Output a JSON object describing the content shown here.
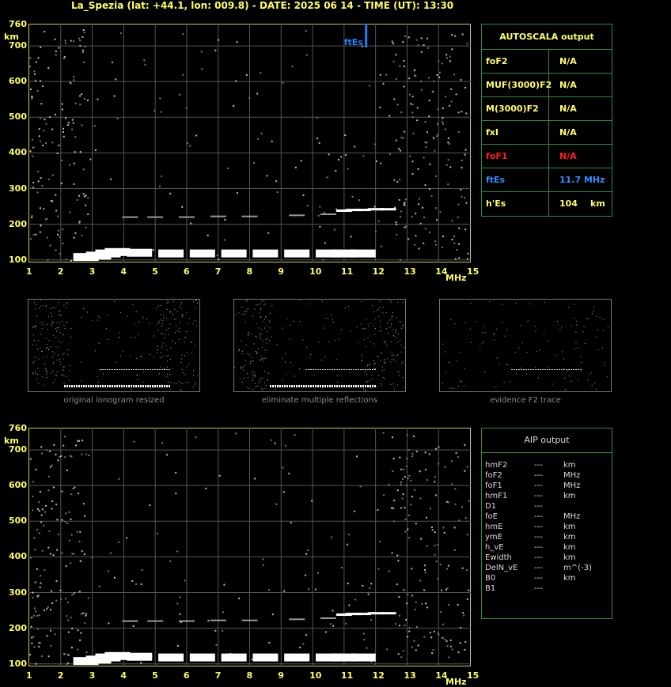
{
  "title": "La_Spezia (lat: +44.1, lon: 009.8) - DATE: 2025 06 14 - TIME (UT): 13:30",
  "chart_data": [
    {
      "type": "scatter",
      "title": "",
      "xlabel": "MHz",
      "ylabel": "km",
      "xlim": [
        1,
        15
      ],
      "ylim": [
        95,
        760
      ],
      "x_ticks": [
        "1",
        "2",
        "3",
        "4",
        "5",
        "6",
        "7",
        "8",
        "9",
        "10",
        "11",
        "12",
        "13",
        "14",
        "15"
      ],
      "y_ticks": [
        "760",
        "700",
        "600",
        "500",
        "400",
        "300",
        "200",
        "100"
      ],
      "grid": true,
      "traces": [
        {
          "name": "E trace",
          "x": [
            2.8,
            3.2,
            3.5,
            3.8,
            4.5,
            5.5,
            6.5,
            7.5,
            8.5,
            9.5,
            10.5,
            11.0,
            11.6
          ],
          "y": [
            108,
            112,
            118,
            122,
            120,
            118,
            118,
            118,
            118,
            118,
            118,
            118,
            118
          ]
        },
        {
          "name": "Es trace",
          "x": [
            11.0,
            11.3,
            11.6,
            12.0,
            12.4
          ],
          "y": [
            238,
            240,
            240,
            242,
            242
          ]
        },
        {
          "name": "faint trace",
          "x": [
            4.2,
            5.0,
            6.0,
            7.0,
            8.0,
            9.5,
            10.5
          ],
          "y": [
            220,
            220,
            220,
            222,
            222,
            225,
            228
          ]
        }
      ],
      "markers": [
        {
          "label": "ftEs",
          "x": 11.7,
          "color": "#1e7fff"
        }
      ]
    },
    {
      "type": "scatter",
      "title": "",
      "xlabel": "MHz",
      "ylabel": "km",
      "xlim": [
        1,
        15
      ],
      "ylim": [
        95,
        760
      ],
      "x_ticks": [
        "1",
        "2",
        "3",
        "4",
        "5",
        "6",
        "7",
        "8",
        "9",
        "10",
        "11",
        "12",
        "13",
        "14",
        "15"
      ],
      "y_ticks": [
        "760",
        "700",
        "600",
        "500",
        "400",
        "300",
        "200",
        "100"
      ],
      "grid": true
    }
  ],
  "autoscala": {
    "title": "AUTOSCALA output",
    "rows": [
      {
        "name": "foF2",
        "value": "N/A",
        "unit": "",
        "color": "#ffff66"
      },
      {
        "name": "MUF(3000)F2",
        "value": "N/A",
        "unit": "",
        "color": "#ffff66"
      },
      {
        "name": "M(3000)F2",
        "value": "N/A",
        "unit": "",
        "color": "#ffff66"
      },
      {
        "name": "fxI",
        "value": "N/A",
        "unit": "",
        "color": "#ffff66"
      },
      {
        "name": "foF1",
        "value": "N/A",
        "unit": "",
        "color": "#ff1e1e"
      },
      {
        "name": "ftEs",
        "value": "11.7 MHz",
        "unit": "",
        "color": "#2f8fff"
      },
      {
        "name": "h'Es",
        "value": "104",
        "unit": "km",
        "color": "#ffff66"
      }
    ]
  },
  "thumbnails": [
    {
      "caption": "original ionogram resized"
    },
    {
      "caption": "eliminate multiple reflections"
    },
    {
      "caption": "evidence F2 trace"
    }
  ],
  "aip": {
    "title": "AIP output",
    "rows": [
      {
        "name": "hmF2",
        "value": "---",
        "unit": "km"
      },
      {
        "name": "foF2",
        "value": "---",
        "unit": "MHz"
      },
      {
        "name": "foF1",
        "value": "---",
        "unit": "MHz"
      },
      {
        "name": "hmF1",
        "value": "---",
        "unit": "km"
      },
      {
        "name": "D1",
        "value": "---",
        "unit": ""
      },
      {
        "name": "foE",
        "value": "---",
        "unit": "MHz"
      },
      {
        "name": "hmE",
        "value": "---",
        "unit": "km"
      },
      {
        "name": "ymE",
        "value": "---",
        "unit": "km"
      },
      {
        "name": "h_vE",
        "value": "---",
        "unit": "km"
      },
      {
        "name": "Ewidth",
        "value": "---",
        "unit": "km"
      },
      {
        "name": "DelN_vE",
        "value": "---",
        "unit": "m^(-3)"
      },
      {
        "name": "B0",
        "value": "---",
        "unit": "km"
      },
      {
        "name": "B1",
        "value": "---",
        "unit": ""
      }
    ]
  }
}
